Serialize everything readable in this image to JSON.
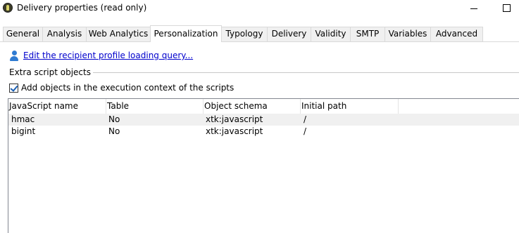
{
  "window": {
    "title": "Delivery properties (read only)"
  },
  "tabs": [
    {
      "label": "General"
    },
    {
      "label": "Analysis"
    },
    {
      "label": "Web Analytics"
    },
    {
      "label": "Personalization",
      "active": true
    },
    {
      "label": "Typology"
    },
    {
      "label": "Delivery"
    },
    {
      "label": "Validity"
    },
    {
      "label": "SMTP"
    },
    {
      "label": "Variables"
    },
    {
      "label": "Advanced"
    }
  ],
  "personalization": {
    "profile_query_link": "Edit the recipient profile loading query...",
    "profile_icon": "person-icon",
    "extra_script_group_label": "Extra script objects",
    "add_objects_checkbox": {
      "label": "Add objects in the execution context of the scripts",
      "checked": true
    }
  },
  "script_table": {
    "columns": [
      "JavaScript name",
      "Table",
      "Object schema",
      "Initial path"
    ],
    "rows": [
      {
        "name": "hmac",
        "table": "No",
        "schema": "xtk:javascript",
        "path": "/"
      },
      {
        "name": "bigint",
        "table": "No",
        "schema": "xtk:javascript",
        "path": "/"
      }
    ]
  },
  "colors": {
    "link": "#0000cc",
    "alt_row": "#f0f0f0",
    "tab_inactive": "#f0f0f0",
    "checkbox_check": "#1a5fb4"
  }
}
